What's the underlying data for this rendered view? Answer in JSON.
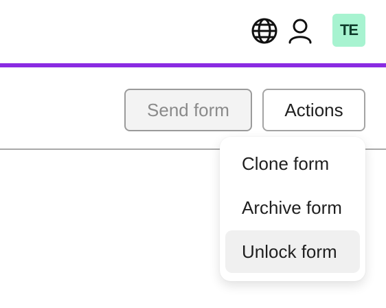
{
  "header": {
    "avatar_initials": "TE",
    "icons": {
      "language": "globe-icon",
      "profile": "user-icon"
    },
    "accent_color": "#8a2be2",
    "avatar_color": "#a7f3d0"
  },
  "toolbar": {
    "send_form_label": "Send form",
    "actions_label": "Actions"
  },
  "actions_menu": {
    "items": [
      {
        "label": "Clone form"
      },
      {
        "label": "Archive form"
      },
      {
        "label": "Unlock form"
      }
    ]
  }
}
